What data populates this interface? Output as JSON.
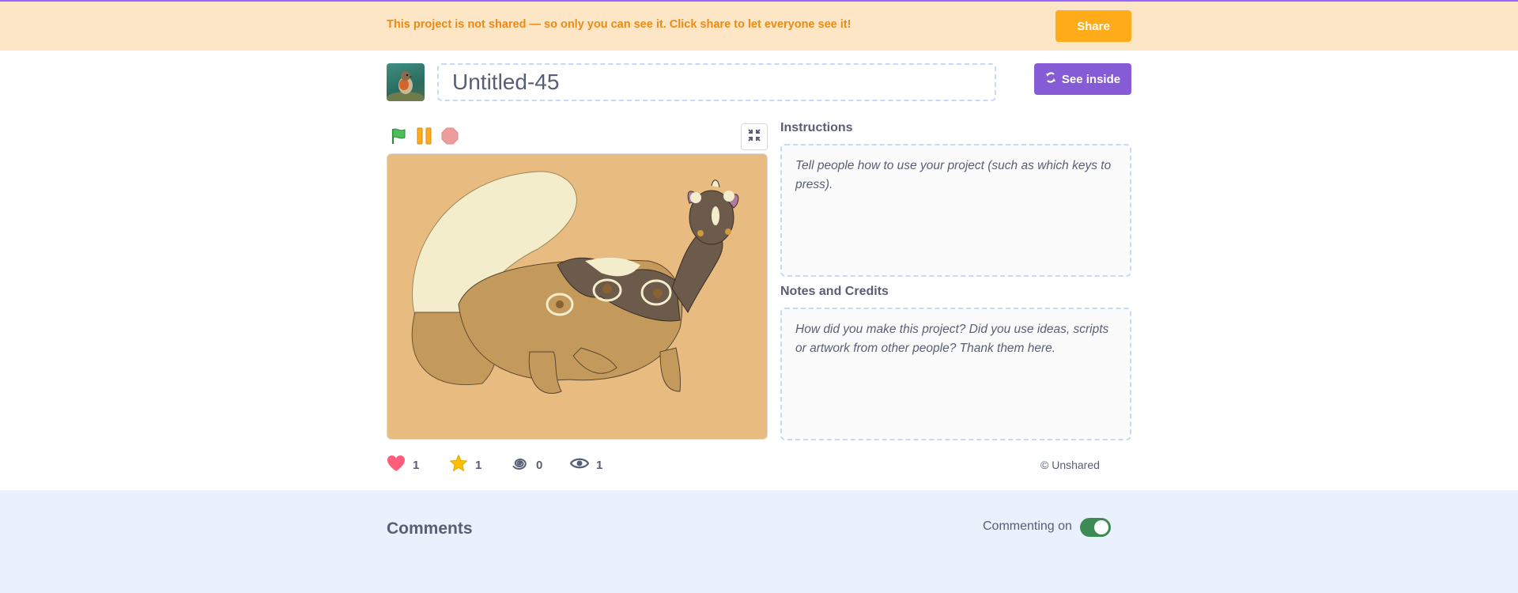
{
  "banner": {
    "message": "This project is not shared — so only you can see it. Click share to let everyone see it!",
    "share_label": "Share"
  },
  "project": {
    "title": "Untitled-45",
    "see_inside_label": "See inside"
  },
  "controls": {
    "icons": [
      "green-flag-icon",
      "pause-icon",
      "stop-icon",
      "fullscreen-icon"
    ]
  },
  "instructions": {
    "label": "Instructions",
    "placeholder": "Tell people how to use your project (such as which keys to press)."
  },
  "notes": {
    "label": "Notes and Credits",
    "placeholder": "How did you make this project? Did you use ideas, scripts or artwork from other people? Thank them here."
  },
  "stats": {
    "loves": "1",
    "favorites": "1",
    "remixes": "0",
    "views": "1"
  },
  "share_status": "© Unshared",
  "comments": {
    "title": "Comments",
    "commenting_label": "Commenting on",
    "commenting_enabled": true
  },
  "colors": {
    "banner_bg": "#fde6c6",
    "banner_text": "#ee8a13",
    "share_button": "#ffab1a",
    "see_inside_button": "#855cd6",
    "stage_bg": "#e8bb80",
    "comments_bg": "#e9f1fc",
    "toggle_on": "#3e8a55"
  }
}
